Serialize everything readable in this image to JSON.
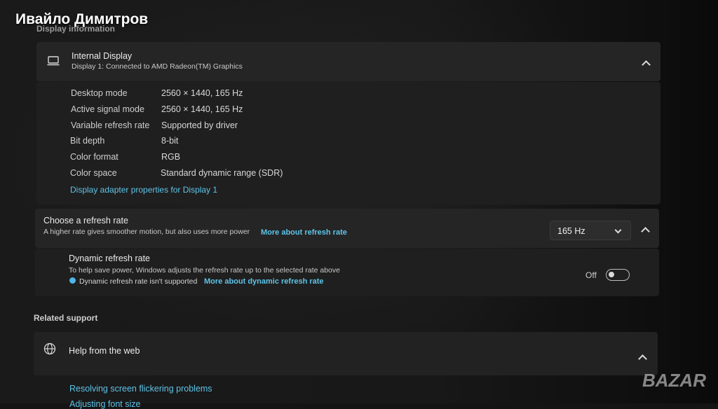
{
  "watermark": {
    "name": "Ивайло Димитров",
    "logo": "BAZAR"
  },
  "display_information": {
    "section_title": "Display information",
    "display": {
      "title": "Internal Display",
      "subtitle": "Display 1: Connected to AMD Radeon(TM) Graphics",
      "icon": "laptop-icon"
    },
    "rows": [
      {
        "label": "Desktop mode",
        "value": "2560 × 1440, 165 Hz"
      },
      {
        "label": "Active signal mode",
        "value": "2560 × 1440, 165 Hz"
      },
      {
        "label": "Variable refresh rate",
        "value": "Supported by driver"
      },
      {
        "label": "Bit depth",
        "value": "8-bit"
      },
      {
        "label": "Color format",
        "value": "RGB"
      },
      {
        "label": "Color space",
        "value": "Standard dynamic range (SDR)"
      }
    ],
    "adapter_link": "Display adapter properties for Display 1"
  },
  "refresh_rate": {
    "title": "Choose a refresh rate",
    "subtitle": "A higher rate gives smoother motion, but also uses more power",
    "link": "More about refresh rate",
    "selected": "165 Hz",
    "dynamic": {
      "title": "Dynamic refresh rate",
      "subtitle": "To help save power, Windows adjusts the refresh rate up to the selected rate above",
      "notice": "Dynamic refresh rate isn't supported",
      "notice_link": "More about dynamic refresh rate",
      "toggle_label": "Off",
      "toggle_on": false
    }
  },
  "related_support": {
    "section_title": "Related support",
    "help": {
      "title": "Help from the web",
      "icon": "globe-icon"
    },
    "links": [
      "Resolving screen flickering problems",
      "Adjusting font size"
    ]
  },
  "colors": {
    "link": "#5ec4e8",
    "background": "#141414",
    "card": "#232323"
  }
}
